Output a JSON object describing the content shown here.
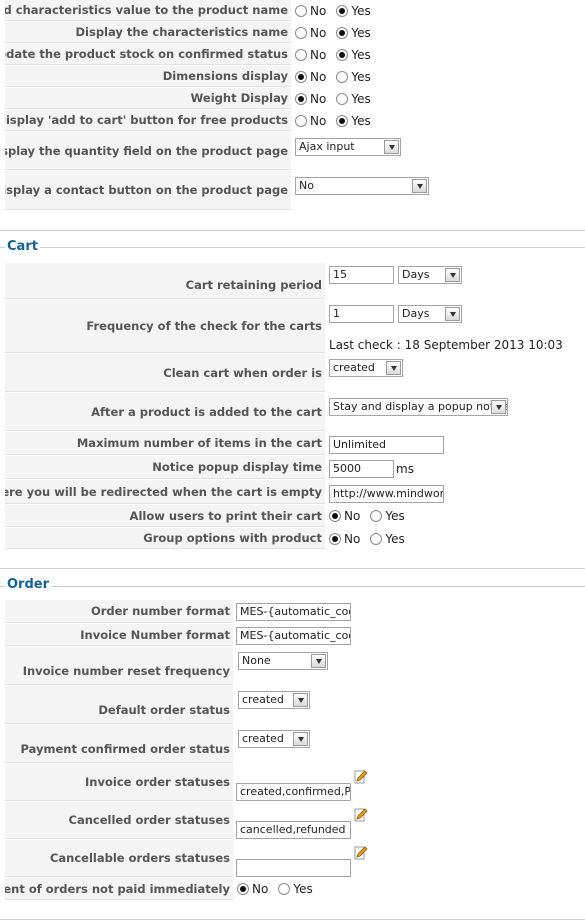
{
  "general": {
    "append_characteristics": {
      "label": "Append characteristics value to the product name",
      "no": "No",
      "yes": "Yes"
    },
    "display_characteristics_name": {
      "label": "Display the characteristics name",
      "no": "No",
      "yes": "Yes"
    },
    "update_stock": {
      "label": "Update the product stock on confirmed status",
      "no": "No",
      "yes": "Yes"
    },
    "dimensions_display": {
      "label": "Dimensions display",
      "no": "No",
      "yes": "Yes"
    },
    "weight_display": {
      "label": "Weight Display",
      "no": "No",
      "yes": "Yes"
    },
    "add_to_cart_free": {
      "label": "Display 'add to cart' button for free products",
      "no": "No",
      "yes": "Yes"
    },
    "quantity_field": {
      "label": "Display the quantity field on the product page",
      "value": "Ajax input"
    },
    "contact_button": {
      "label": "Display a contact button on the product page",
      "value": "No"
    }
  },
  "cart": {
    "legend": "Cart",
    "retaining_period": {
      "label": "Cart retaining period",
      "value": "15",
      "unit": "Days"
    },
    "check_frequency": {
      "label": "Frequency of the check for the carts",
      "value": "1",
      "unit": "Days",
      "last_check": "Last check : 18 September 2013 10:03"
    },
    "clean_cart": {
      "label": "Clean cart when order is",
      "value": "created"
    },
    "after_add": {
      "label": "After a product is added to the cart",
      "value": "Stay and display a popup notice"
    },
    "max_items": {
      "label": "Maximum number of items in the cart",
      "value": "Unlimited"
    },
    "popup_time": {
      "label": "Notice popup display time",
      "value": "5000",
      "unit": "ms"
    },
    "empty_redirect": {
      "label": "URL where you will be redirected when the cart is empty",
      "value": "http://www.mindworkse"
    },
    "print_cart": {
      "label": "Allow users to print their cart",
      "no": "No",
      "yes": "Yes"
    },
    "group_options": {
      "label": "Group options with product",
      "no": "No",
      "yes": "Yes"
    }
  },
  "order": {
    "legend": "Order",
    "order_number_format": {
      "label": "Order number format",
      "value": "MES-{automatic_code}"
    },
    "invoice_number_format": {
      "label": "Invoice Number format",
      "value": "MES-{automatic_code}"
    },
    "invoice_reset": {
      "label": "Invoice number reset frequency",
      "value": "None"
    },
    "default_status": {
      "label": "Default order status",
      "value": "created"
    },
    "payment_confirmed_status": {
      "label": "Payment confirmed order status",
      "value": "created"
    },
    "invoice_statuses": {
      "label": "Invoice order statuses",
      "value": "created,confirmed,Pend"
    },
    "cancelled_statuses": {
      "label": "Cancelled order statuses",
      "value": "cancelled,refunded"
    },
    "cancellable_statuses": {
      "label": "Cancellable orders statuses",
      "value": ""
    },
    "payment_not_immediate": {
      "label": "Payment of orders not paid immediately",
      "no": "No",
      "yes": "Yes"
    }
  }
}
